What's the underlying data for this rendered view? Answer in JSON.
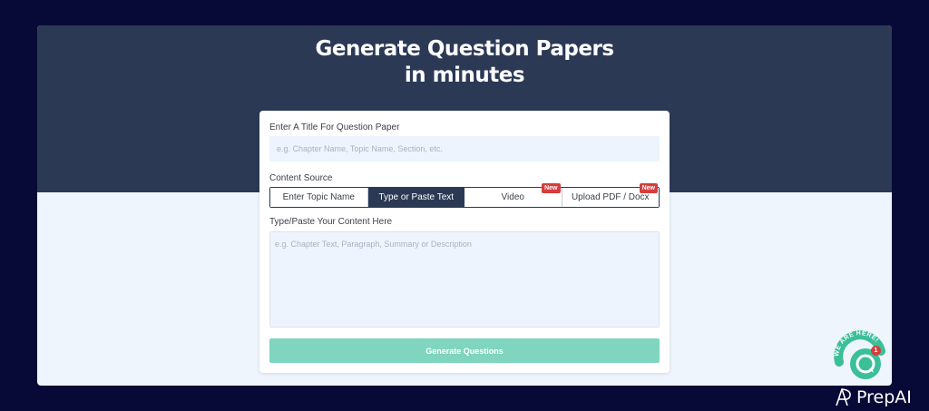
{
  "hero": {
    "line1": "Generate Question Papers",
    "line2": "in minutes"
  },
  "form": {
    "title_label": "Enter A Title For Question Paper",
    "title_placeholder": "e.g. Chapter Name, Topic Name, Section, etc.",
    "source_label": "Content Source",
    "tabs": [
      {
        "label": "Enter Topic Name",
        "active": false
      },
      {
        "label": "Type or Paste Text",
        "active": true
      },
      {
        "label": "Video",
        "active": false,
        "badge": "New"
      },
      {
        "label": "Upload PDF / Docx",
        "active": false,
        "badge": "New"
      }
    ],
    "content_label": "Type/Paste Your Content Here",
    "content_placeholder": "e.g. Chapter Text, Paragraph, Summary or Description",
    "submit_label": "Generate Questions"
  },
  "chat_widget": {
    "arc_text": "WE ARE HERE!",
    "unread_count": "1"
  },
  "brand": {
    "name": "PrepAI"
  },
  "colors": {
    "page_bg": "#070a37",
    "hero_bg": "#2b3955",
    "panel_bg": "#eff5fd",
    "active_tab": "#2b3955",
    "submit_button": "#7fd5bd",
    "badge": "#d63d3d",
    "chat_accent": "#3bbf99"
  },
  "icons": {
    "chat": "chat-bubble-icon",
    "brand": "prepai-logo-icon"
  }
}
